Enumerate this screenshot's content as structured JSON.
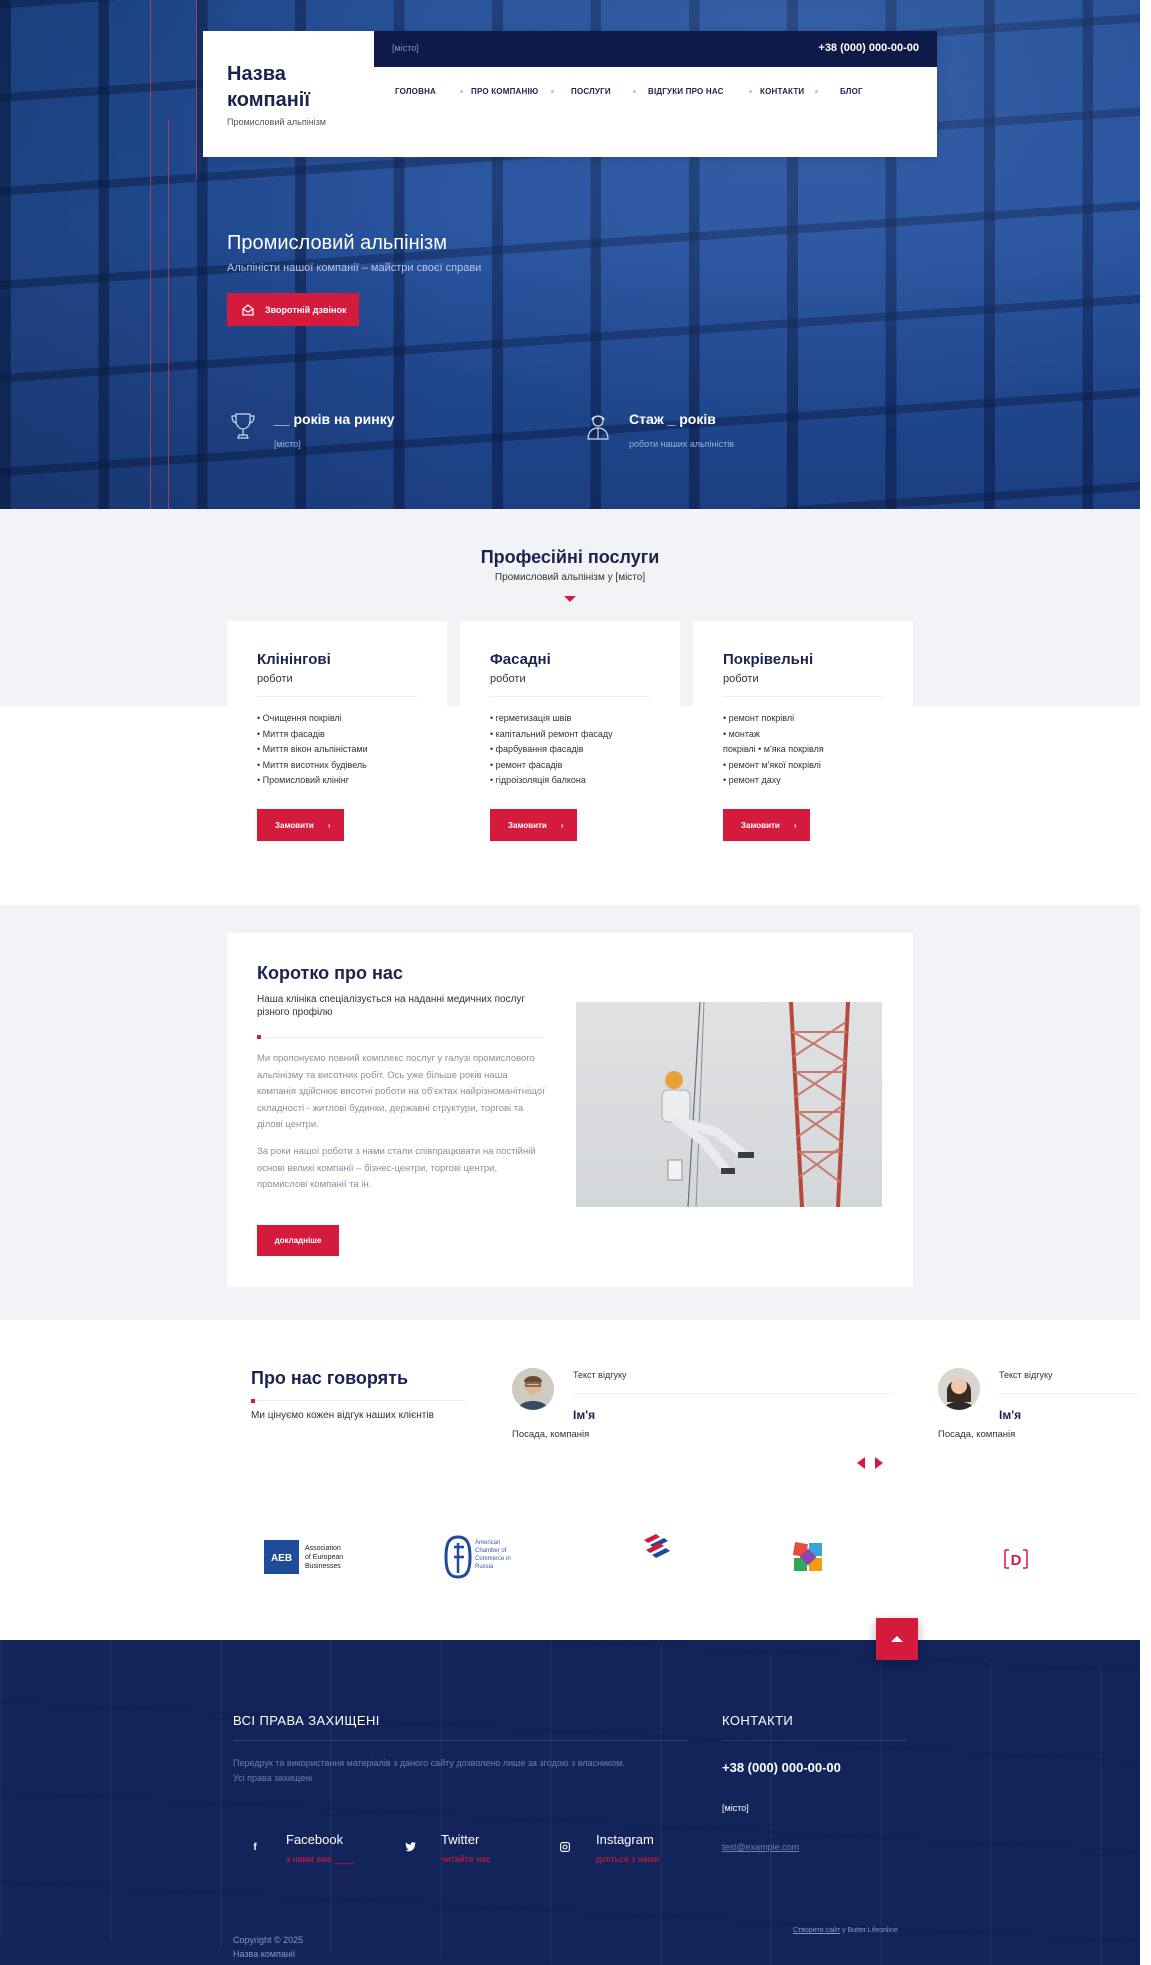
{
  "header": {
    "company_name": "Назва компанії",
    "tagline": "Промисловий альпінізм",
    "city": "[місто]",
    "phone": "+38 (000) 000-00-00",
    "nav": [
      "ГОЛОВНА",
      "ПРО КОМПАНІЮ",
      "ПОСЛУГИ",
      "ВІДГУКИ ПРО НАС",
      "КОНТАКТИ",
      "БЛОГ"
    ]
  },
  "hero": {
    "title": "Промисловий альпінізм",
    "subtitle": "Альпіністи нашої компанії – майстри своєї справи",
    "callback_label": "Зворотній дзвінок",
    "stats": [
      {
        "icon": "trophy-icon",
        "value": "__ років на ринку",
        "caption": "[місто]"
      },
      {
        "icon": "worker-icon",
        "value": "Стаж _ років",
        "caption": "роботи наших альпіністів"
      }
    ]
  },
  "services": {
    "title": "Професійні послуги",
    "subtitle": "Промисловий альпінізм у [місто]",
    "cards": [
      {
        "title": "Клінінгові",
        "subtitle": "роботи",
        "items": [
          "• Очищення покрівлі",
          "• Миття фасадів",
          "• Миття вікон альпіністами",
          "• Миття висотних будівель",
          "• Промисловий клінінг"
        ],
        "button": "Замовити"
      },
      {
        "title": "Фасадні",
        "subtitle": "роботи",
        "items": [
          "• герметизація швів",
          "• капітальний ремонт фасаду",
          "• фарбування фасадів",
          "• ремонт фасадів",
          "• гідроізоляція балкона"
        ],
        "button": "Замовити"
      },
      {
        "title": "Покрівельні",
        "subtitle": "роботи",
        "items": [
          "• ремонт покрівлі",
          "• монтаж",
          "покрівлі • м'яка покрівля",
          "• ремонт м'якої покрівлі",
          "• ремонт даху"
        ],
        "button": "Замовити"
      }
    ]
  },
  "about": {
    "title": "Коротко про нас",
    "subtitle": "Наша клініка спеціалізується на наданні медичних послуг різного профілю",
    "paragraph1": "Ми пропонуємо повний комплекс послуг у галузі промислового альпінізму та висотних робіт. Ось уже більше років наша компанія здійснює висотні роботи на об'єктах найрізноманітніщої складності - житлові будинки, державні структури, торгові та ділові центри.",
    "paragraph2": "За роки нашої роботи з нами стали співпрацювати на постійній основі великі компанії – бізнес-центри, торгові центри, промислові компанії та ін.",
    "button": "докладніше"
  },
  "testimonials": {
    "title": "Про нас говорять",
    "subtitle": "Ми цінуємо кожен відгук наших клієнтів",
    "reviews": [
      {
        "text": "Текст відгуку",
        "name": "Ім'я",
        "position": "Посада, компанія"
      },
      {
        "text": "Текст відгуку",
        "name": "Ім'я",
        "position": "Посада, компанія"
      }
    ]
  },
  "partners": {
    "aeb": [
      "Association",
      "of European",
      "Businesses"
    ],
    "aeb_badge": "AEB",
    "amcham": [
      "American",
      "Chamber of",
      "Commerce in",
      "Russia"
    ],
    "d_logo": "D"
  },
  "footer": {
    "rights_title": "ВСІ ПРАВА ЗАХИЩЕНІ",
    "rights_text": "Передрук та використання матеріалів з даного сайту дозволено лише за згодою з власником. Усі права захищені",
    "social": [
      {
        "icon": "facebook-icon",
        "glyph": "f",
        "name": "Facebook",
        "sub": "з нами вже ____"
      },
      {
        "icon": "twitter-icon",
        "glyph": "🐦",
        "name": "Twitter",
        "sub": "читайте нас"
      },
      {
        "icon": "instagram-icon",
        "glyph": "◎",
        "name": "Instagram",
        "sub": "діліться з нами"
      }
    ],
    "contacts_title": "КОНТАКТИ",
    "phone": "+38 (000) 000-00-00",
    "city": "[місто]",
    "email": "test@example.com",
    "copyright": "Copyright © 2025",
    "company": "Назва компанії",
    "made_link": "Створити сайт",
    "made_rest": "у Butter.Lifeonline"
  },
  "colors": {
    "accent": "#d41b3d",
    "navy": "#0e1a47",
    "text": "#1b2350",
    "light_bg": "#f2f3f6",
    "footer": "#13245a"
  }
}
